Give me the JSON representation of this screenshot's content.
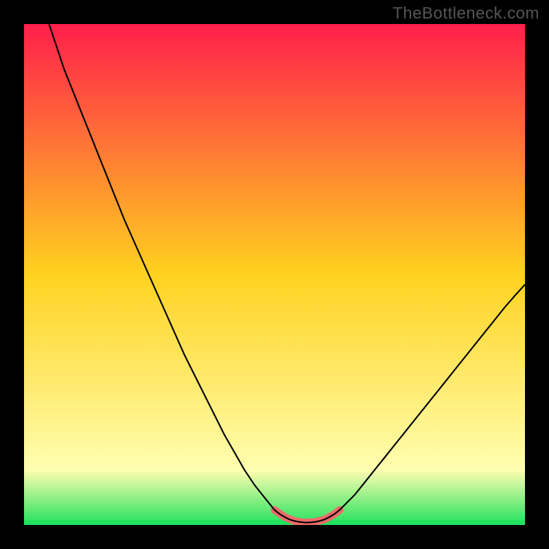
{
  "watermark": "TheBottleneck.com",
  "colors": {
    "frame": "#000000",
    "watermark": "#555555",
    "curve_black": "#000000",
    "dip_highlight": "#f06a6a",
    "green_band": "#23e25e",
    "gradient_top": "#ff1f4b",
    "gradient_mid": "#ffd21f",
    "gradient_bottom": "#fffeb0"
  },
  "chart_data": {
    "type": "line",
    "title": "",
    "xlabel": "",
    "ylabel": "",
    "xlim": [
      0,
      100
    ],
    "ylim": [
      0,
      100
    ],
    "x": [
      5,
      6,
      7,
      8,
      9,
      10,
      11,
      12,
      13,
      14,
      15,
      16,
      17,
      18,
      19,
      20,
      22,
      24,
      26,
      28,
      30,
      32,
      34,
      36,
      38,
      40,
      42,
      44,
      46,
      48,
      50,
      51,
      52,
      53,
      54,
      55,
      56,
      57,
      58,
      59,
      60,
      61,
      62,
      63,
      64,
      66,
      68,
      70,
      72,
      74,
      76,
      78,
      80,
      82,
      84,
      86,
      88,
      90,
      92,
      94,
      96,
      98,
      100
    ],
    "y": [
      100,
      97,
      94,
      91,
      88.5,
      86,
      83.5,
      81,
      78.5,
      76,
      73.5,
      71,
      68.5,
      66,
      63.5,
      61,
      56.5,
      52,
      47.5,
      43,
      38.5,
      34,
      30,
      26,
      22,
      18,
      14.5,
      11,
      8,
      5.5,
      3,
      2.2,
      1.6,
      1.1,
      0.8,
      0.6,
      0.5,
      0.5,
      0.6,
      0.8,
      1.1,
      1.6,
      2.2,
      3,
      4,
      6,
      8.5,
      11,
      13.5,
      16,
      18.5,
      21,
      23.5,
      26,
      28.5,
      31,
      33.5,
      36,
      38.5,
      41,
      43.5,
      45.8,
      48
    ],
    "dip_region": {
      "x": [
        50,
        52,
        54,
        55,
        56,
        58,
        60,
        62,
        63
      ],
      "y": [
        3,
        1.6,
        0.8,
        0.6,
        0.5,
        0.6,
        1.1,
        2.2,
        3
      ]
    }
  }
}
